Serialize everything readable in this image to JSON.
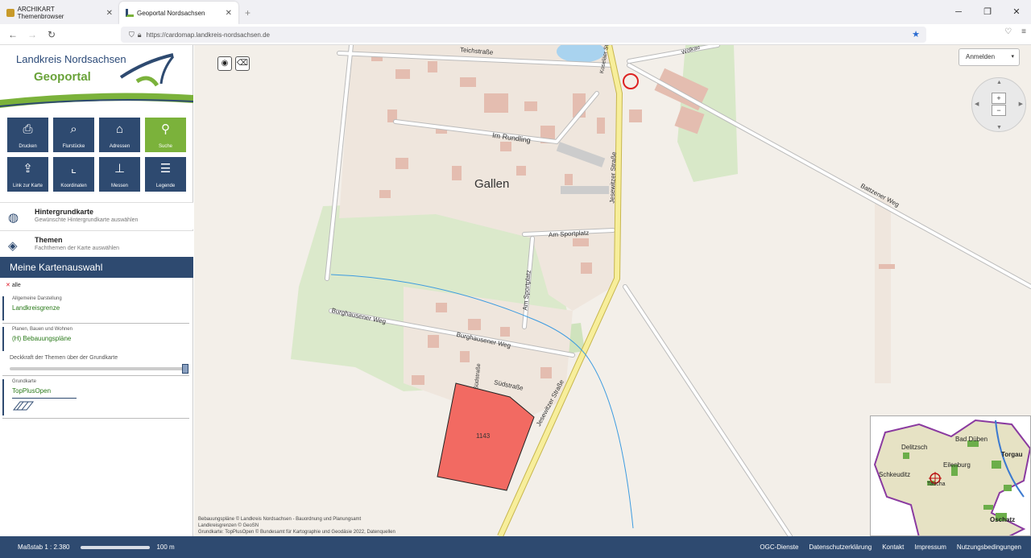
{
  "browser": {
    "tabs": [
      {
        "title": "ARCHIKART Themenbrowser",
        "active": false
      },
      {
        "title": "Geoportal Nordsachsen",
        "active": true
      }
    ],
    "url": "https://cardomap.landkreis-nordsachsen.de"
  },
  "sidebar": {
    "logo_line1": "Landkreis Nordsachsen",
    "logo_line2": "Geoportal",
    "tools": [
      {
        "label": "Drucken",
        "icon": "printer-icon"
      },
      {
        "label": "Flurstücke",
        "icon": "parcel-search-icon"
      },
      {
        "label": "Adressen",
        "icon": "address-search-icon"
      },
      {
        "label": "Suche",
        "icon": "search-icon"
      },
      {
        "label": "Link zur Karte",
        "icon": "map-link-icon"
      },
      {
        "label": "Koordinaten",
        "icon": "coordinates-icon"
      },
      {
        "label": "Messen",
        "icon": "measure-icon"
      },
      {
        "label": "Legende",
        "icon": "legend-icon"
      }
    ],
    "basemap": {
      "title": "Hintergrundkarte",
      "subtitle": "Gewünschte Hintergrundkarte auswählen"
    },
    "themes": {
      "title": "Themen",
      "subtitle": "Fachthemen der Karte auswählen"
    },
    "my_maps": {
      "title": "Meine Kartenauswahl",
      "clear_all": "alle",
      "layers": [
        {
          "group": "Allgemeine Darstellung",
          "name": "Landkreisgrenze"
        },
        {
          "group": "Planen, Bauen und Wohnen",
          "name": "(H) Bebauungspläne"
        }
      ],
      "opacity_label": "Deckkraft der Themen über der Grundkarte",
      "opacity": 1.0,
      "basemap_group": "Grundkarte",
      "basemap_name": "TopPlusOpen"
    }
  },
  "map": {
    "login_label": "Anmelden",
    "labels": {
      "teichstrasse": "Teichstraße",
      "koselaer": "Koseläer Str.",
      "woelkau": "Wölkau",
      "im_rundling": "Im Rundling",
      "gallen": "Gallen",
      "jesewitzer_strasse": "Jesewitzer Straße",
      "jesewitzer_strasse2": "Jesewitzer Straße",
      "bottzener_weg": "Battzener Weg",
      "am_sportplatz": "Am Sportplatz",
      "am_sportplatz2": "Am Sportplatz",
      "burghausener_weg": "Burghausener Weg",
      "burghausener_weg2": "Burghausener Weg",
      "suedstrasse": "Südstraße",
      "suedstrasse2": "Südstraße",
      "plan_id": "1143"
    },
    "attribution": [
      "Bebauungspläne © Landkreis Nordsachsen - Bauordnung und Planungsamt",
      "Landkreisgrenzen © GeoSN",
      "Grundkarte: TopPlusOpen © Bundesamt für Kartographie und Geodäsie 2022, Datenquellen"
    ],
    "overview_labels": [
      "Delitzsch",
      "Bad Düben",
      "Torgau",
      "Eilenburg",
      "Schkeuditz",
      "Taucha",
      "Oschatz"
    ]
  },
  "footer": {
    "scale": "Maßstab 1 : 2.380",
    "scale_length": "100 m",
    "links": [
      "OGC-Dienste",
      "Datenschutzerklärung",
      "Kontakt",
      "Impressum",
      "Nutzungsbedingungen"
    ]
  },
  "colors": {
    "navy": "#2e4a70",
    "green": "#7bb23b",
    "plan_fill": "#f26a62"
  }
}
